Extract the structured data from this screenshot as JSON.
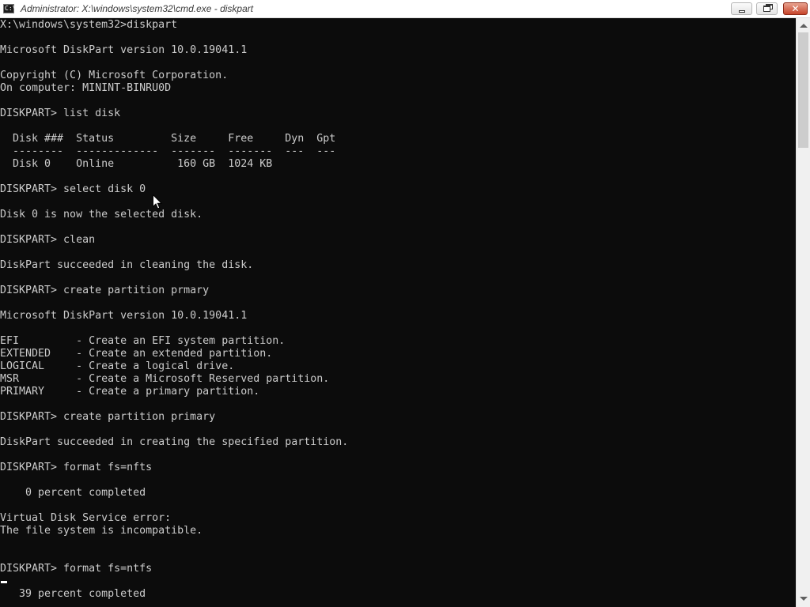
{
  "window": {
    "title": "Administrator: X:\\windows\\system32\\cmd.exe - diskpart",
    "icon": "cmd-icon",
    "icon_text": "C:\\"
  },
  "controls": {
    "minimize_icon": "minimize-icon",
    "maximize_icon": "restore-icon",
    "close_icon": "close-icon",
    "close_glyph": "✕"
  },
  "console": {
    "background": "#0c0c0c",
    "foreground": "#cccccc",
    "lines": [
      "X:\\windows\\system32>diskpart",
      "",
      "Microsoft DiskPart version 10.0.19041.1",
      "",
      "Copyright (C) Microsoft Corporation.",
      "On computer: MININT-BINRU0D",
      "",
      "DISKPART> list disk",
      "",
      "  Disk ###  Status         Size     Free     Dyn  Gpt",
      "  --------  -------------  -------  -------  ---  ---",
      "  Disk 0    Online          160 GB  1024 KB",
      "",
      "DISKPART> select disk 0",
      "",
      "Disk 0 is now the selected disk.",
      "",
      "DISKPART> clean",
      "",
      "DiskPart succeeded in cleaning the disk.",
      "",
      "DISKPART> create partition prmary",
      "",
      "Microsoft DiskPart version 10.0.19041.1",
      "",
      "EFI         - Create an EFI system partition.",
      "EXTENDED    - Create an extended partition.",
      "LOGICAL     - Create a logical drive.",
      "MSR         - Create a Microsoft Reserved partition.",
      "PRIMARY     - Create a primary partition.",
      "",
      "DISKPART> create partition primary",
      "",
      "DiskPart succeeded in creating the specified partition.",
      "",
      "DISKPART> format fs=nfts",
      "",
      "    0 percent completed",
      "",
      "Virtual Disk Service error:",
      "The file system is incompatible.",
      "",
      "",
      "DISKPART> format fs=ntfs",
      "",
      "   39 percent completed"
    ]
  },
  "scrollbar": {
    "up_icon": "scroll-up-arrow-icon",
    "down_icon": "scroll-down-arrow-icon"
  }
}
